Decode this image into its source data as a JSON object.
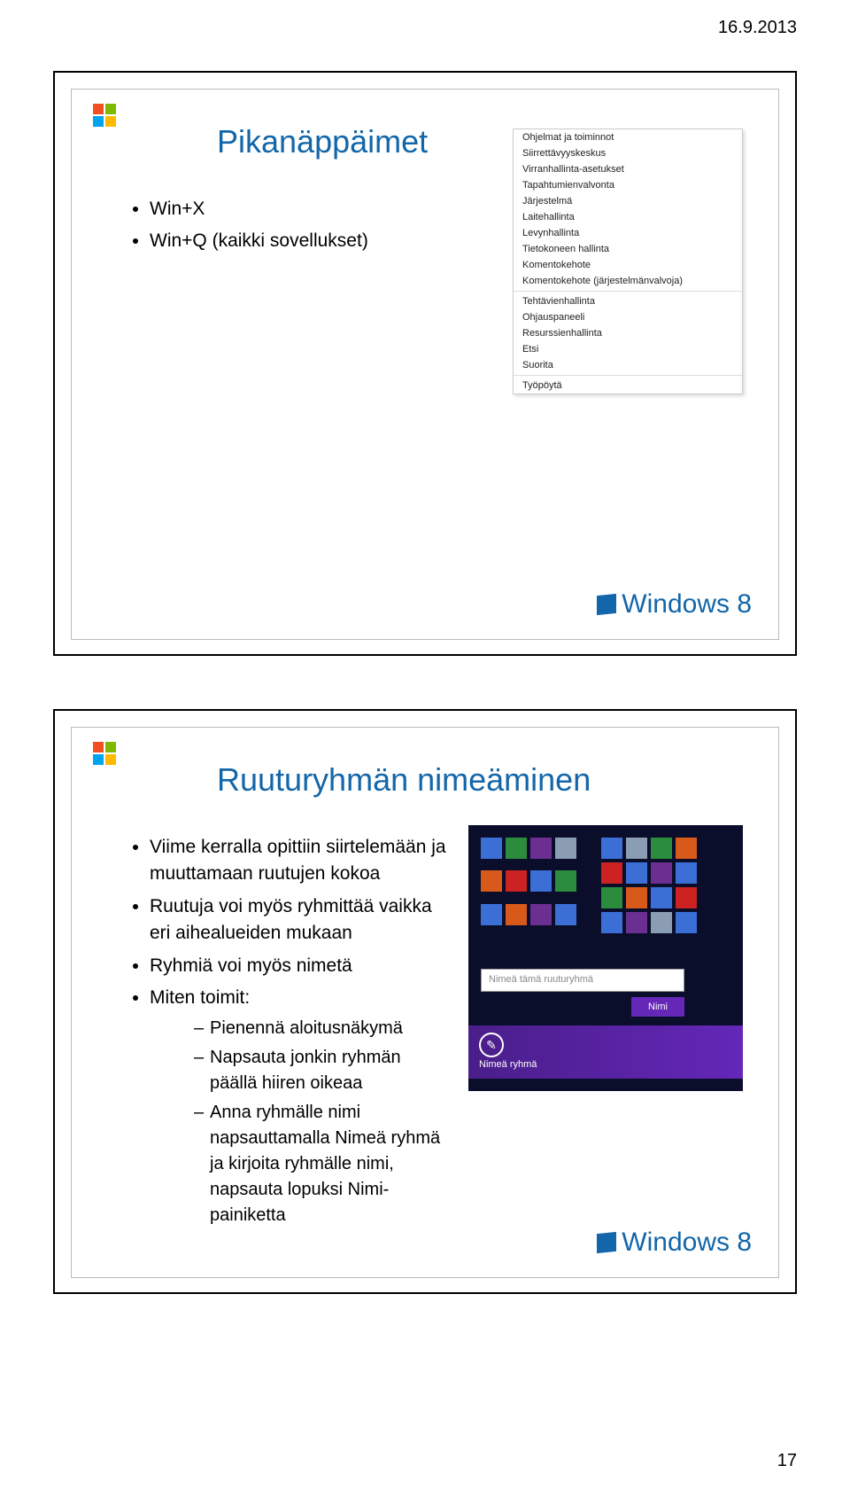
{
  "document": {
    "header_date": "16.9.2013",
    "page_number": "17"
  },
  "slide1": {
    "title": "Pikanäppäimet",
    "bullets": [
      "Win+X",
      "Win+Q (kaikki sovellukset)"
    ],
    "context_menu_items": [
      "Ohjelmat ja toiminnot",
      "Siirrettävyyskeskus",
      "Virranhallinta-asetukset",
      "Tapahtumienvalvonta",
      "Järjestelmä",
      "Laitehallinta",
      "Levynhallinta",
      "Tietokoneen hallinta",
      "Komentokehote",
      "Komentokehote (järjestelmänvalvoja)",
      "Tehtävienhallinta",
      "Ohjauspaneeli",
      "Resurssienhallinta",
      "Etsi",
      "Suorita",
      "Työpöytä"
    ],
    "brand": "Windows 8"
  },
  "slide2": {
    "title": "Ruuturyhmän nimeäminen",
    "bullets": [
      "Viime kerralla opittiin siirtelemään ja muuttamaan ruutujen kokoa",
      "Ruutuja voi myös ryhmittää vaikka eri aihealueiden mukaan",
      "Ryhmiä voi myös nimetä",
      "Miten toimit:"
    ],
    "subbullets": [
      "Pienennä aloitusnäkymä",
      "Napsauta jonkin ryhmän päällä hiiren oikeaa",
      "Anna ryhmälle nimi napsauttamalla Nimeä ryhmä ja kirjoita ryhmälle nimi, napsauta lopuksi Nimi-painiketta"
    ],
    "mock": {
      "input_placeholder": "Nimeä tämä ruuturyhmä",
      "button_label": "Nimi",
      "bottom_label": "Nimeä ryhmä"
    },
    "brand": "Windows 8"
  }
}
